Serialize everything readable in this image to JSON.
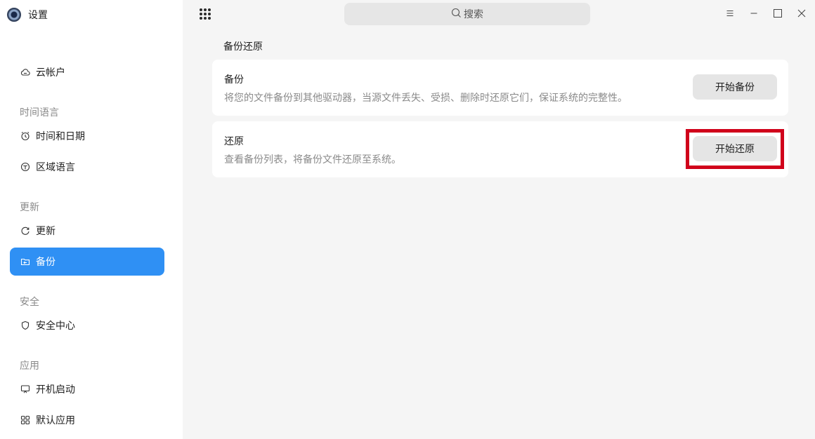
{
  "app": {
    "title": "设置"
  },
  "sidebar": {
    "items": [
      {
        "type": "item",
        "label": "云帐户",
        "icon": "cloud-icon",
        "active": false
      },
      {
        "type": "group",
        "label": "时间语言"
      },
      {
        "type": "item",
        "label": "时间和日期",
        "icon": "clock-icon",
        "active": false
      },
      {
        "type": "item",
        "label": "区域语言",
        "icon": "globe-icon",
        "active": false
      },
      {
        "type": "group",
        "label": "更新"
      },
      {
        "type": "item",
        "label": "更新",
        "icon": "refresh-icon",
        "active": false
      },
      {
        "type": "item",
        "label": "备份",
        "icon": "backup-folder-icon",
        "active": true
      },
      {
        "type": "group",
        "label": "安全"
      },
      {
        "type": "item",
        "label": "安全中心",
        "icon": "shield-icon",
        "active": false
      },
      {
        "type": "group",
        "label": "应用"
      },
      {
        "type": "item",
        "label": "开机启动",
        "icon": "monitor-icon",
        "active": false
      },
      {
        "type": "item",
        "label": "默认应用",
        "icon": "grid-icon",
        "active": false
      }
    ]
  },
  "search": {
    "placeholder": "搜索"
  },
  "main": {
    "heading": "备份还原",
    "cards": [
      {
        "title": "备份",
        "description": "将您的文件备份到其他驱动器，当源文件丢失、受损、删除时还原它们，保证系统的完整性。",
        "button": "开始备份",
        "highlighted": false
      },
      {
        "title": "还原",
        "description": "查看备份列表，将备份文件还原至系统。",
        "button": "开始还原",
        "highlighted": true
      }
    ]
  },
  "colors": {
    "accent": "#2f90f4",
    "highlight": "#d0021b",
    "content_bg": "#f5f5f5"
  }
}
